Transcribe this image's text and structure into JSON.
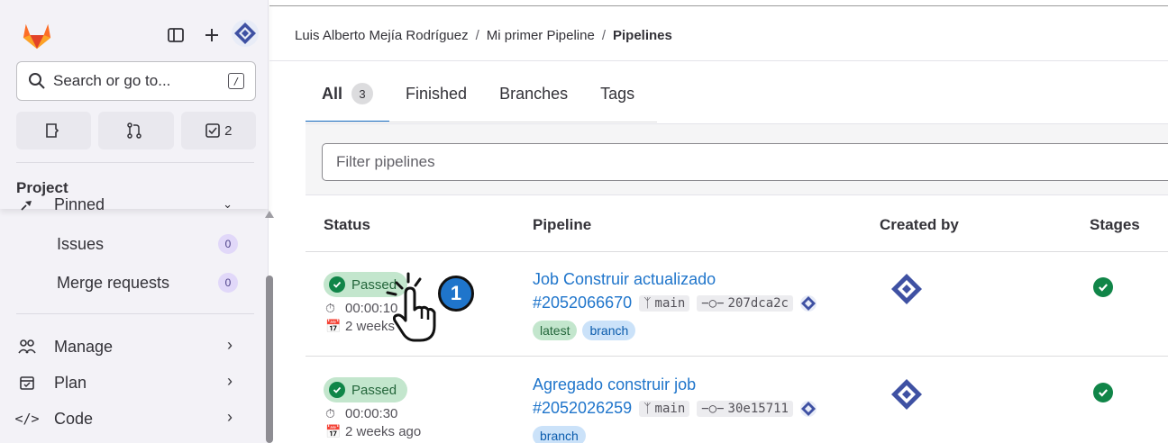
{
  "sidebar": {
    "search_placeholder": "Search or go to...",
    "search_shortcut": "/",
    "counters": [
      {
        "icon": "issues-icon",
        "count": ""
      },
      {
        "icon": "merge-request-icon",
        "count": ""
      },
      {
        "icon": "todo-icon",
        "count": "2"
      }
    ],
    "section_title": "Project",
    "pinned_label": "Pinned",
    "items": [
      {
        "label": "Issues",
        "count": "0"
      },
      {
        "label": "Merge requests",
        "count": "0"
      },
      {
        "label": "Manage",
        "icon": "manage-icon"
      },
      {
        "label": "Plan",
        "icon": "plan-icon"
      },
      {
        "label": "Code",
        "icon": "code-icon"
      }
    ]
  },
  "breadcrumb": {
    "owner": "Luis Alberto Mejía Rodríguez",
    "project": "Mi primer Pipeline",
    "current": "Pipelines",
    "separator": "/"
  },
  "tabs": [
    {
      "label": "All",
      "count": "3"
    },
    {
      "label": "Finished"
    },
    {
      "label": "Branches"
    },
    {
      "label": "Tags"
    }
  ],
  "filter": {
    "placeholder": "Filter pipelines"
  },
  "table": {
    "headers": [
      "Status",
      "Pipeline",
      "Created by",
      "Stages"
    ],
    "rows": [
      {
        "status": "Passed",
        "duration": "00:00:10",
        "age": "2 weeks ago",
        "title": "Job Construir actualizado",
        "id": "#2052066670",
        "branch": "main",
        "commit": "207dca2c",
        "tags": [
          "latest",
          "branch"
        ]
      },
      {
        "status": "Passed",
        "duration": "00:00:30",
        "age": "2 weeks ago",
        "title": "Agregado construir job",
        "id": "#2052026259",
        "branch": "main",
        "commit": "30e15711",
        "tags": [
          "branch"
        ]
      }
    ]
  },
  "overlay": {
    "step_number": "1"
  },
  "colors": {
    "accent": "#1f75cb",
    "success": "#108548",
    "success_bg": "#c3e6cd",
    "sidebar_bg": "#f3f2f7"
  }
}
